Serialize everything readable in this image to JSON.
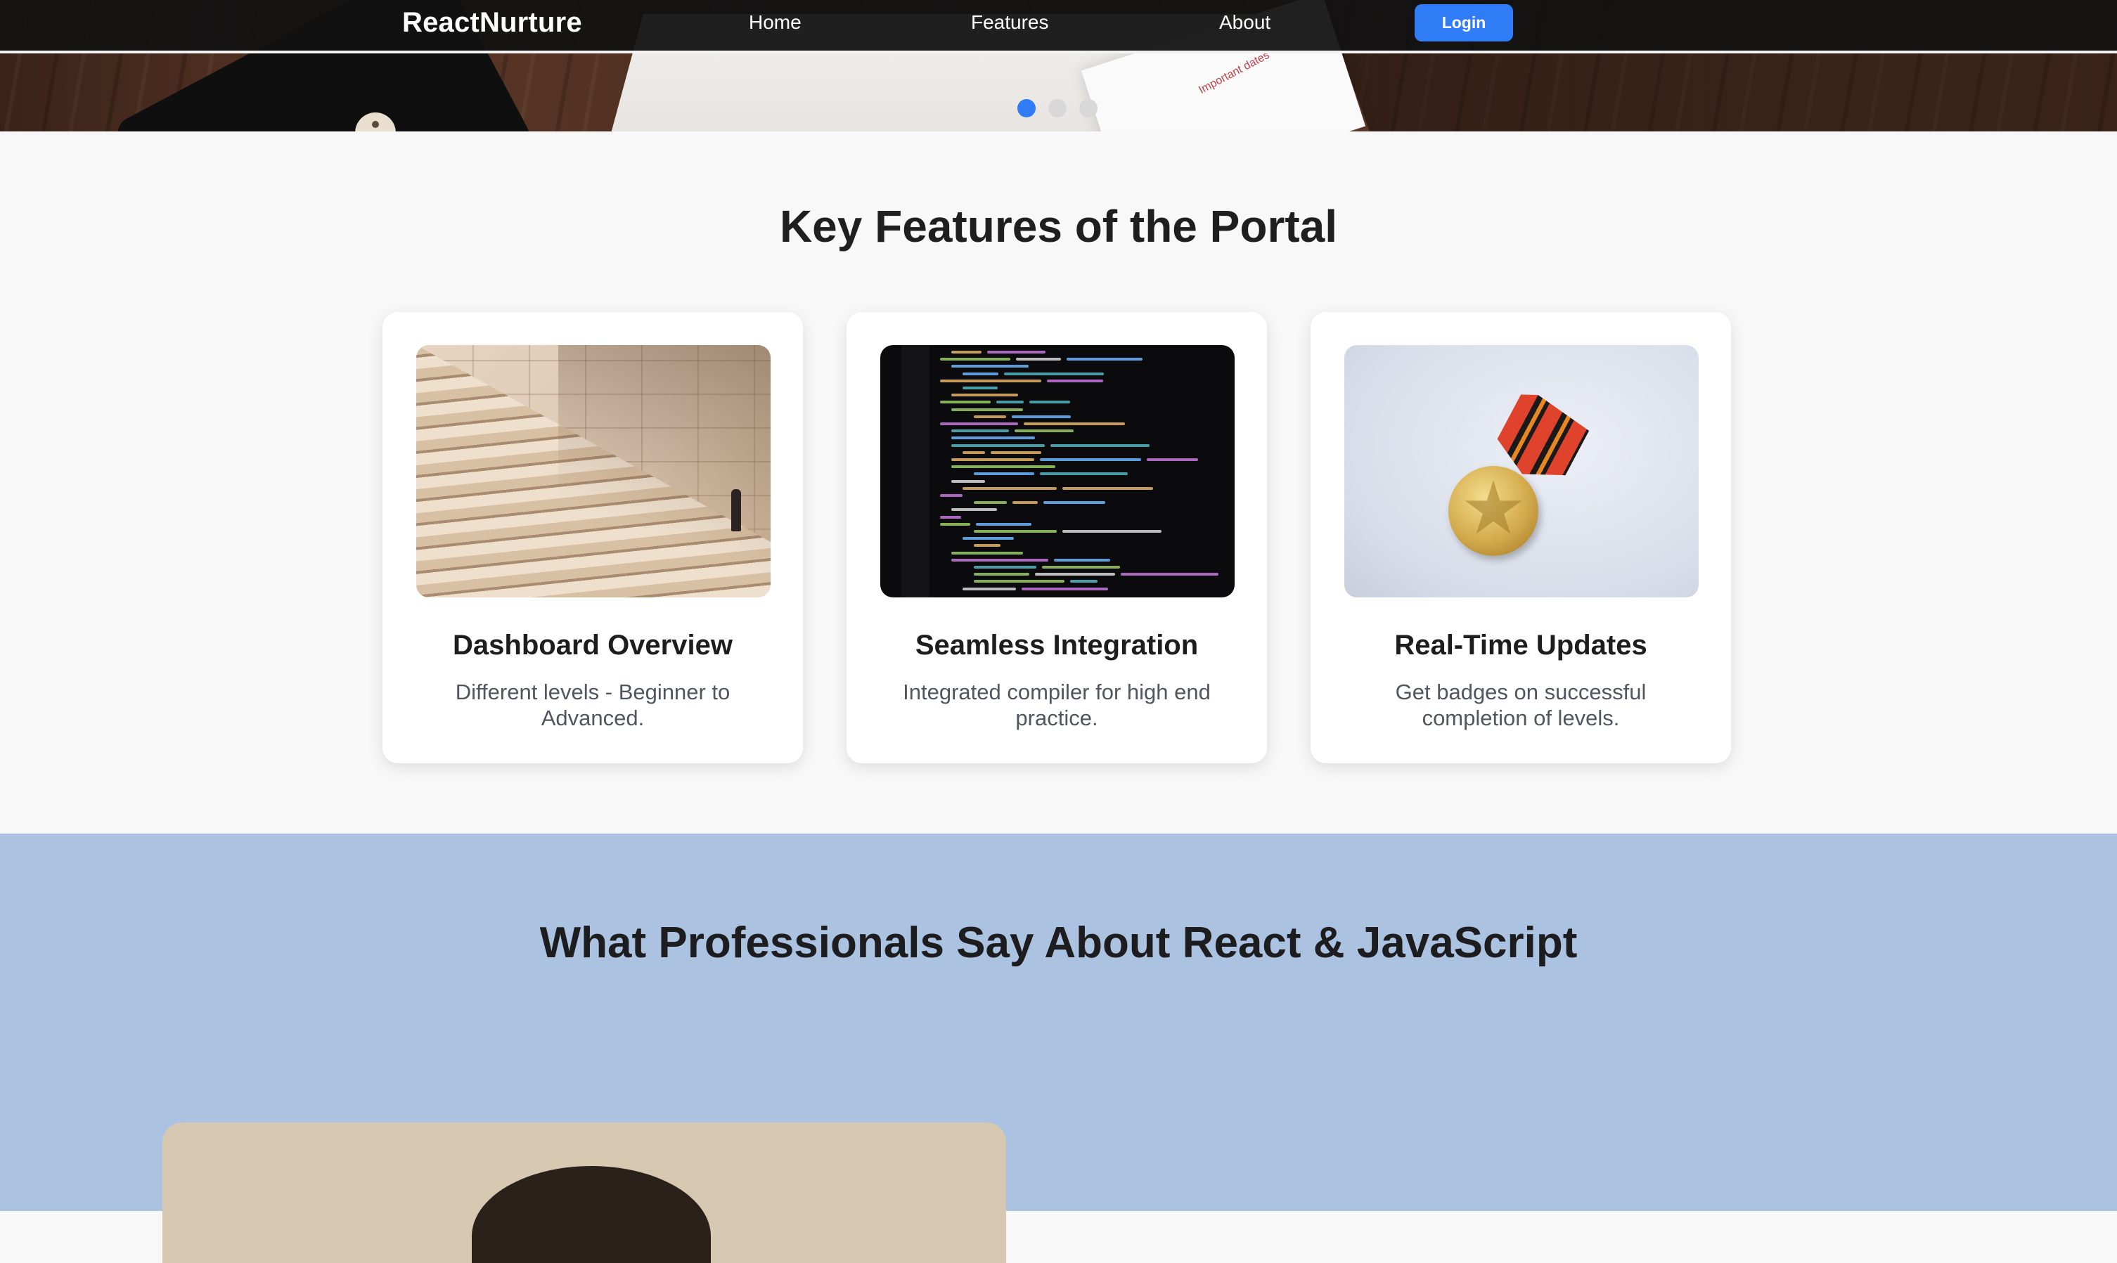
{
  "nav": {
    "brand": "ReactNurture",
    "links": [
      "Home",
      "Features",
      "About"
    ],
    "login": "Login"
  },
  "hero": {
    "slide_count": 3,
    "active_slide": 1,
    "card_text": "Important dates"
  },
  "features": {
    "title": "Key Features of the Portal",
    "cards": [
      {
        "image": "stairs-photo",
        "title": "Dashboard Overview",
        "desc": "Different levels - Beginner to Advanced."
      },
      {
        "image": "code-screen-photo",
        "title": "Seamless Integration",
        "desc": "Integrated compiler for high end practice."
      },
      {
        "image": "medal-photo",
        "title": "Real-Time Updates",
        "desc": "Get badges on successful completion of levels."
      }
    ]
  },
  "testimonials": {
    "title": "What Professionals Say About React & JavaScript"
  },
  "colors": {
    "accent": "#2f7cf6",
    "navbar": "#121212",
    "testimonials_bg": "#abc2e0",
    "features_bg": "#f8f8f8"
  }
}
